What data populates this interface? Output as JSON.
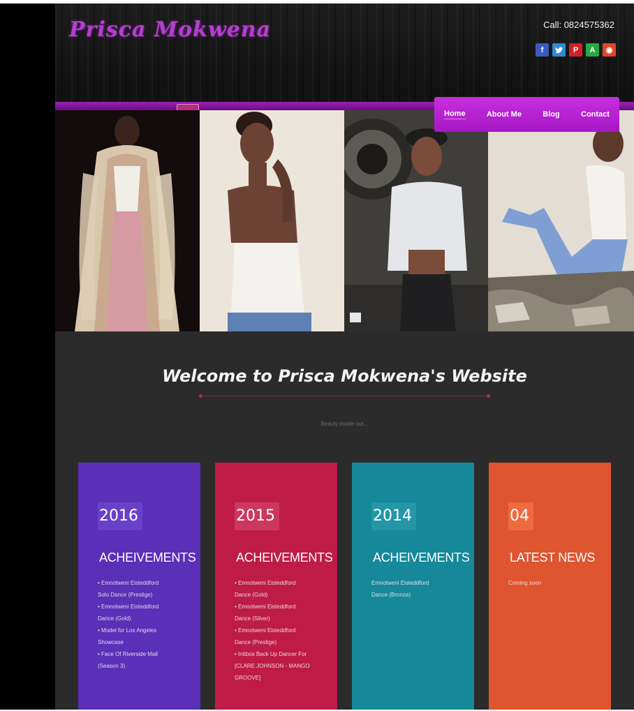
{
  "header": {
    "logo_text": "Prisca Mokwena",
    "phone_label": "Call: 0824575362"
  },
  "social": [
    {
      "name": "facebook-icon",
      "glyph": "f",
      "color": "#3b5bbd"
    },
    {
      "name": "twitter-icon",
      "glyph": "✉",
      "color": "#2d8bd6"
    },
    {
      "name": "pinterest-icon",
      "glyph": "P",
      "color": "#d0202b"
    },
    {
      "name": "android-icon",
      "glyph": "A",
      "color": "#26a843"
    },
    {
      "name": "googleplus-icon",
      "glyph": "◉",
      "color": "#e2462a"
    }
  ],
  "nav": {
    "home": "Home",
    "about": "About Me",
    "blog": "Blog",
    "contact": "Contact"
  },
  "welcome": {
    "title": "Welcome to Prisca Mokwena's Website",
    "tagline": "Beauty inside out..."
  },
  "cards": [
    {
      "year": "2016",
      "title": "ACHEIVEMENTS",
      "color": "#5b2fb8",
      "year_bg": "#6a40c9",
      "items": [
        "• Emnotweni Eisteddford",
        "Solo Dance (Prestige)",
        "• Emnotweni Eisteddford",
        "Dance (Gold)",
        "• Model for Los Angeles",
        "Showcase",
        "• Face Of Riverside Mall",
        "(Season 3)"
      ]
    },
    {
      "year": "2015",
      "title": "ACHEIVEMENTS",
      "color": "#be1b49",
      "year_bg": "#cc3760",
      "items": [
        "• Emnotweni Eisteddford",
        "Dance (Gold)",
        "• Emnotweni Eisteddford",
        "Dance (Silver)",
        "• Emnotweni Eisteddford",
        "Dance (Prestige)",
        "• Intibos Back Up Dancer For",
        "[CLARE JOHNSON - MANGO",
        "GROOVE]"
      ]
    },
    {
      "year": "2014",
      "title": "ACHEIVEMENTS",
      "color": "#15899a",
      "year_bg": "#2596a6",
      "items": [
        "Emnotweni Eisteddford",
        "Dance (Bronze)"
      ]
    },
    {
      "year": "04",
      "title": "LATEST NEWS",
      "color": "#de552f",
      "year_bg": "#ee6a3f",
      "items": [
        "Coming soon"
      ]
    }
  ]
}
